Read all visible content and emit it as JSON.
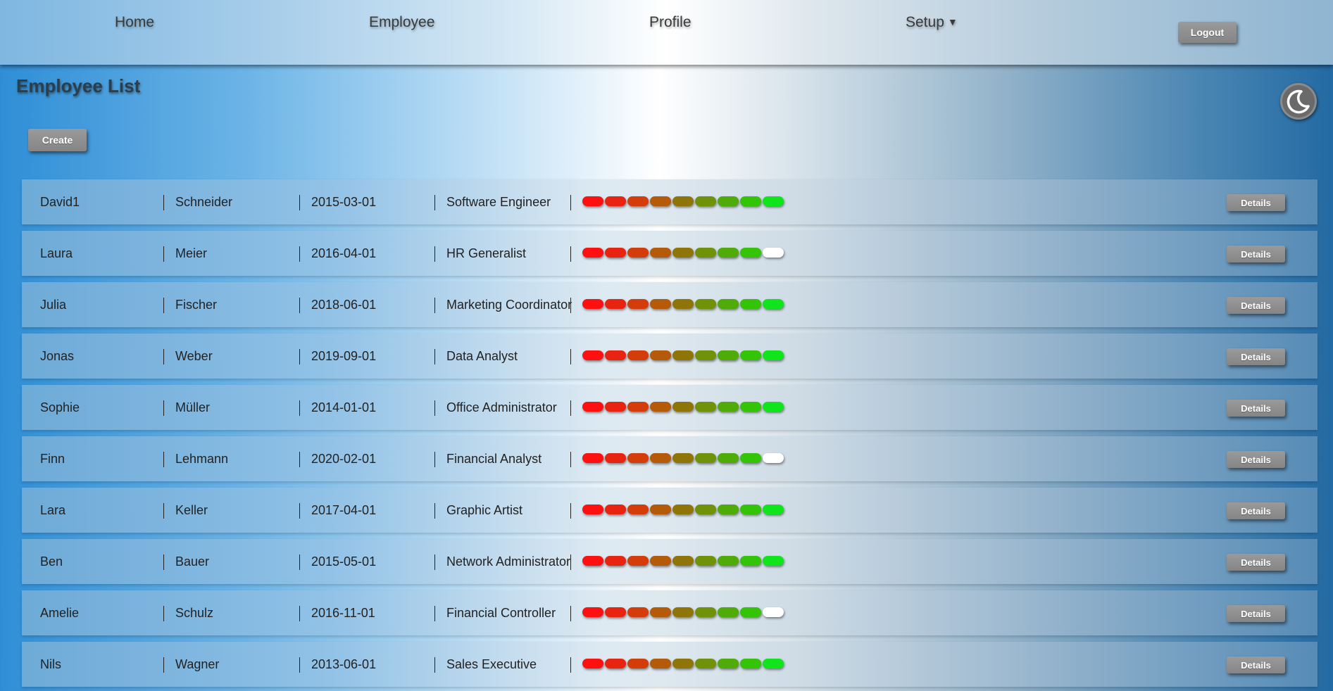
{
  "nav": {
    "home": "Home",
    "employee": "Employee",
    "profile": "Profile",
    "setup": "Setup",
    "setup_caret": "▼",
    "logout": "Logout"
  },
  "page": {
    "title": "Employee List",
    "create_label": "Create",
    "details_label": "Details"
  },
  "theme_toggle_icon": "moon-icon",
  "rating_colors": [
    "#ff1010",
    "#e82410",
    "#d43c0a",
    "#b45a08",
    "#8f7408",
    "#6f9208",
    "#4fab08",
    "#33c408",
    "#10e41a"
  ],
  "rating_empty_color": "#ffffff",
  "employees": [
    {
      "first": "David1",
      "last": "Schneider",
      "date": "2015-03-01",
      "title": "Software Engineer",
      "rating": 9
    },
    {
      "first": "Laura",
      "last": "Meier",
      "date": "2016-04-01",
      "title": "HR Generalist",
      "rating": 8
    },
    {
      "first": "Julia",
      "last": "Fischer",
      "date": "2018-06-01",
      "title": "Marketing Coordinator",
      "rating": 9
    },
    {
      "first": "Jonas",
      "last": "Weber",
      "date": "2019-09-01",
      "title": "Data Analyst",
      "rating": 9
    },
    {
      "first": "Sophie",
      "last": "Müller",
      "date": "2014-01-01",
      "title": "Office Administrator",
      "rating": 9
    },
    {
      "first": "Finn",
      "last": "Lehmann",
      "date": "2020-02-01",
      "title": "Financial Analyst",
      "rating": 8
    },
    {
      "first": "Lara",
      "last": "Keller",
      "date": "2017-04-01",
      "title": "Graphic Artist",
      "rating": 9
    },
    {
      "first": "Ben",
      "last": "Bauer",
      "date": "2015-05-01",
      "title": "Network Administrator",
      "rating": 9
    },
    {
      "first": "Amelie",
      "last": "Schulz",
      "date": "2016-11-01",
      "title": "Financial Controller",
      "rating": 8
    },
    {
      "first": "Nils",
      "last": "Wagner",
      "date": "2013-06-01",
      "title": "Sales Executive",
      "rating": 9
    }
  ]
}
